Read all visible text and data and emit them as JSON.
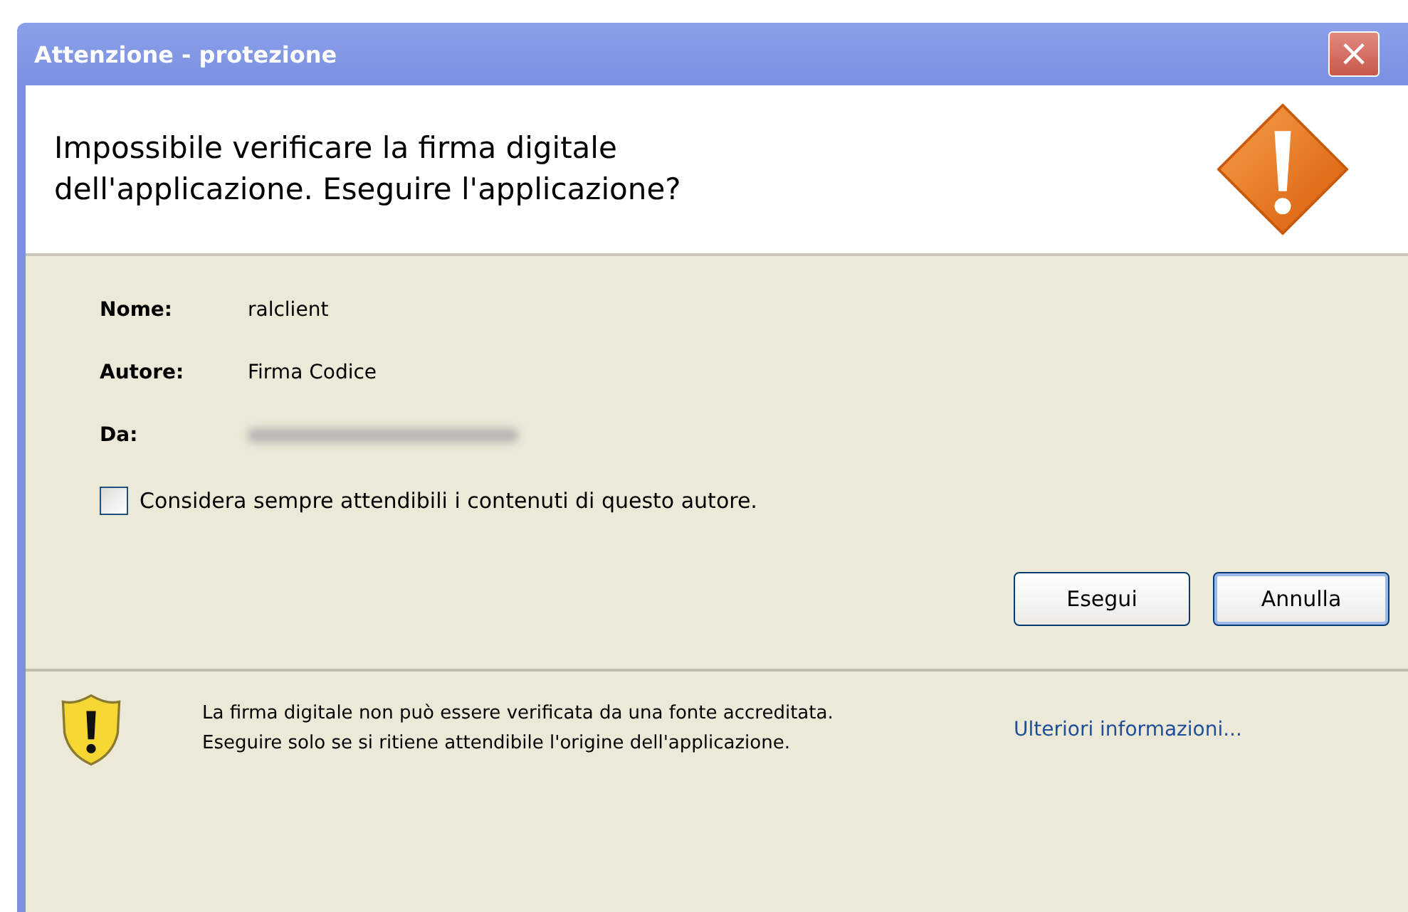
{
  "window": {
    "title": "Attenzione - protezione",
    "close": "×"
  },
  "header": {
    "message": "Impossibile verificare la firma digitale dell'applicazione.  Eseguire l'applicazione?"
  },
  "details": [
    {
      "label": "Nome:",
      "value": "ralclient",
      "blurred": false
    },
    {
      "label": "Autore:",
      "value": "Firma Codice",
      "blurred": false
    },
    {
      "label": "Da:",
      "blurred": true
    }
  ],
  "trust_checkbox": {
    "label": "Considera sempre attendibili i contenuti di questo autore.",
    "checked": false
  },
  "buttons": [
    {
      "label": "Esegui",
      "default": false
    },
    {
      "label": "Annulla",
      "default": true
    }
  ],
  "footer": {
    "message": "La firma digitale non può essere verificata da una fonte accreditata.  Eseguire solo se si ritiene attendibile l'origine dell'applicazione.",
    "link": "Ulteriori informazioni..."
  }
}
